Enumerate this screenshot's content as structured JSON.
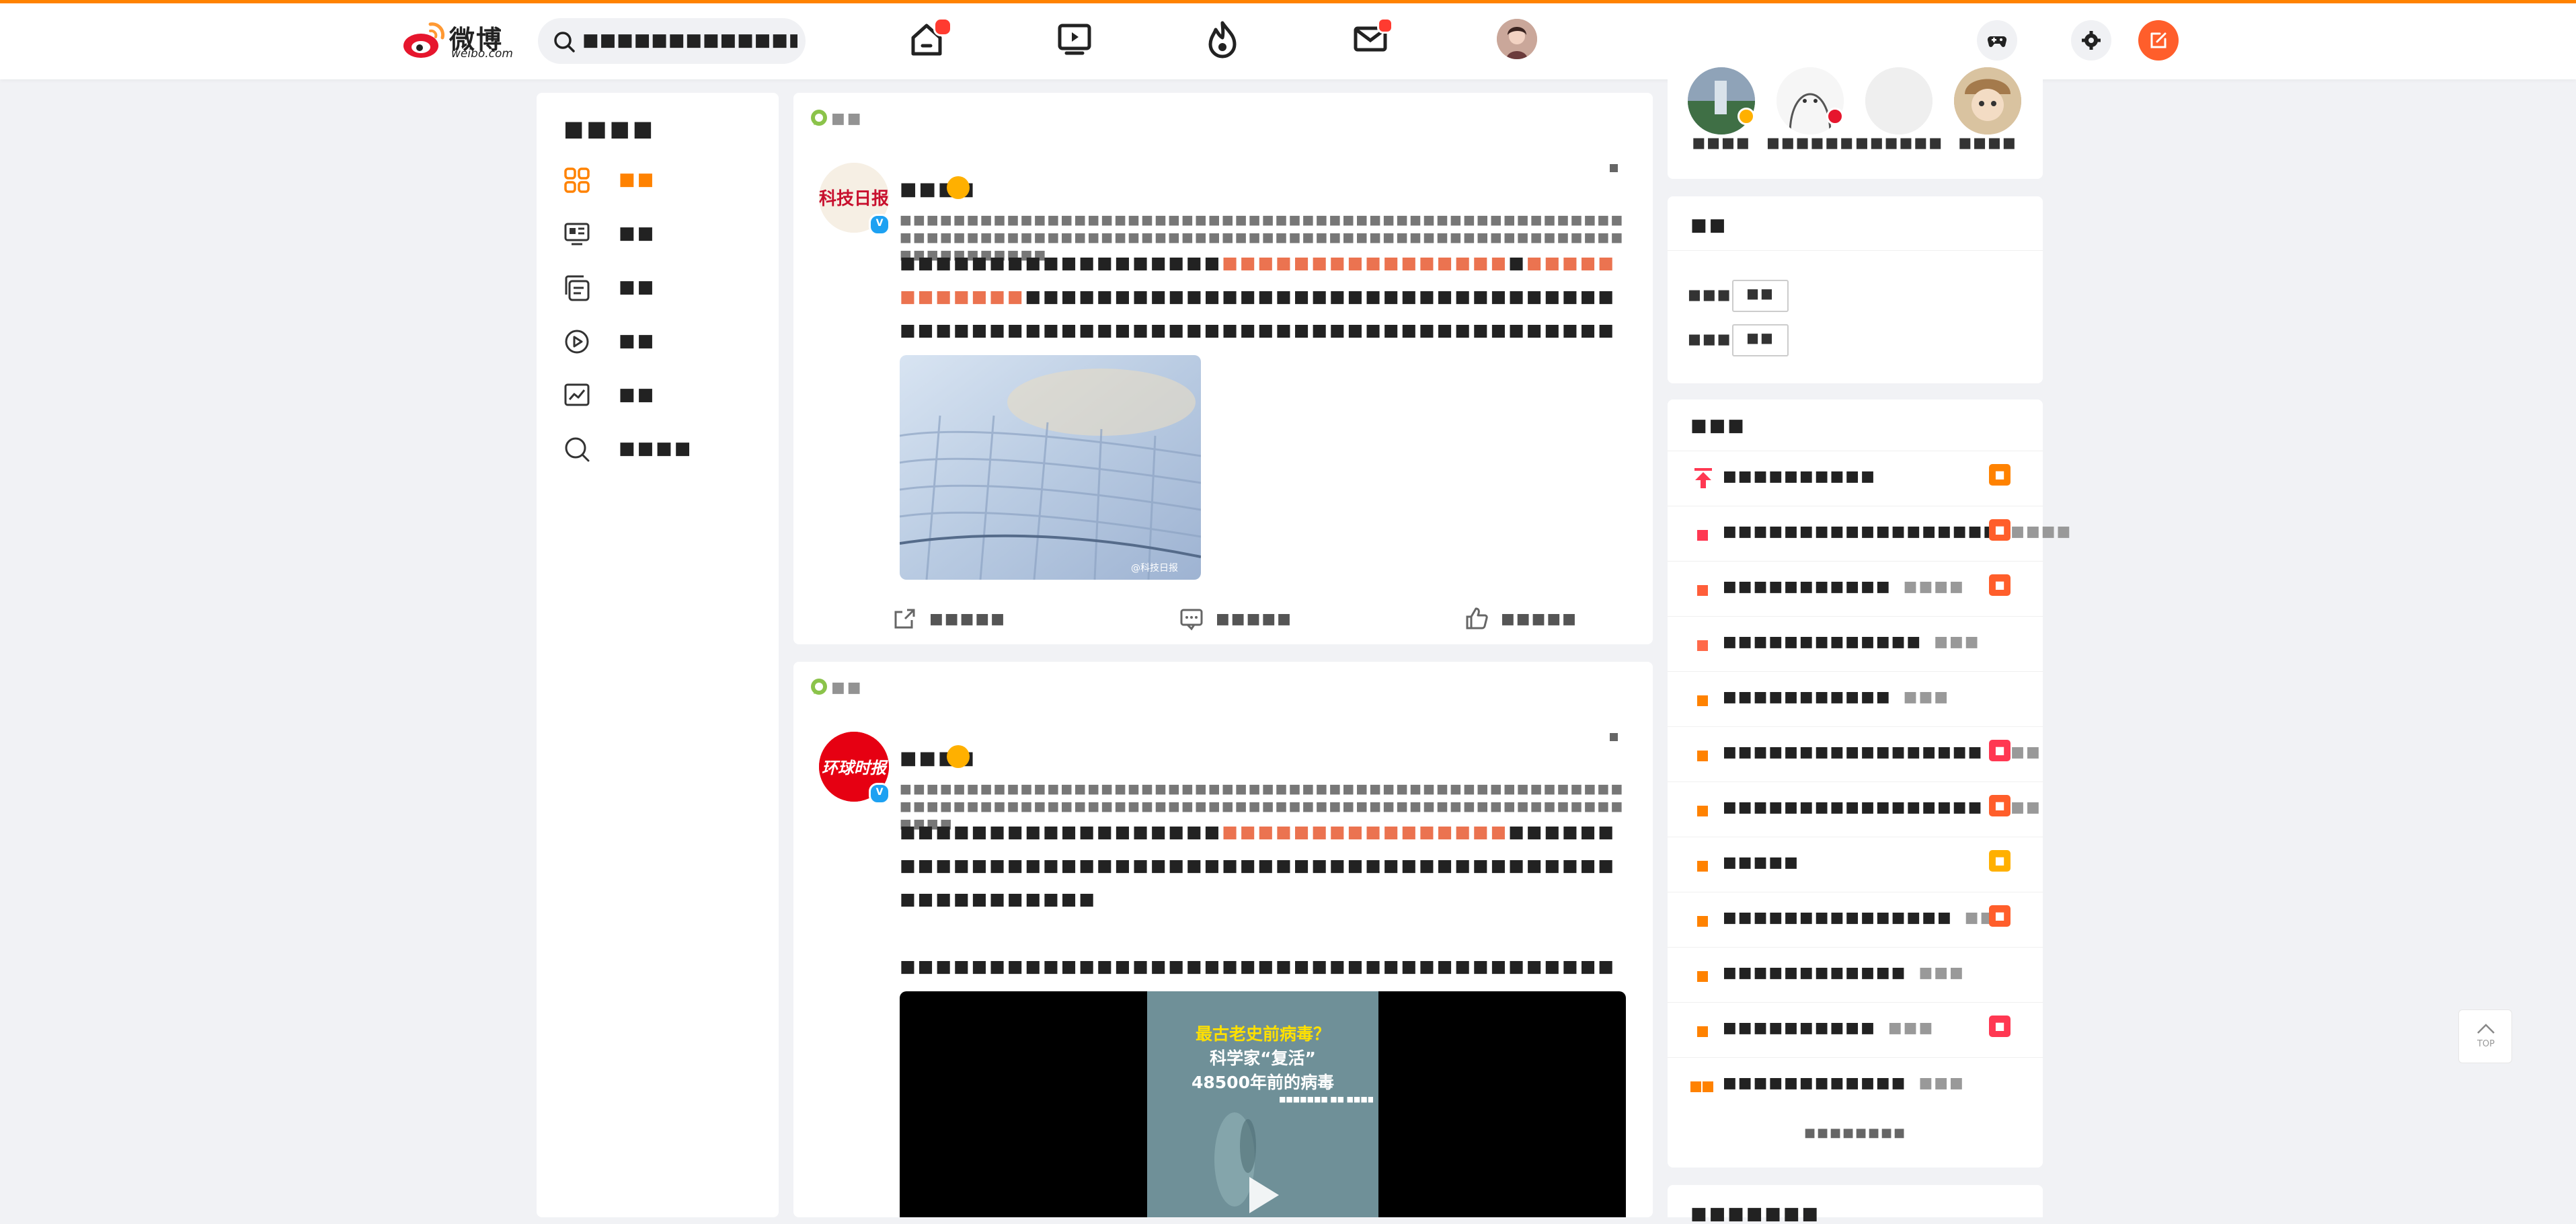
{
  "header": {
    "logo_text": "微博",
    "logo_sub": "weibo.com",
    "search_placeholder": "■■■■■■■■■■■■■■■■■■■■"
  },
  "left_nav": {
    "title": "■■■■",
    "items": [
      {
        "label": "■■",
        "icon": "grid-icon",
        "active": true
      },
      {
        "label": "■■",
        "icon": "news-icon"
      },
      {
        "label": "■■",
        "icon": "album-icon"
      },
      {
        "label": "■■",
        "icon": "video-play-icon"
      },
      {
        "label": "■■",
        "icon": "trend-chart-icon"
      },
      {
        "label": "■■■■",
        "icon": "search-icon"
      }
    ]
  },
  "feed": [
    {
      "source_label": "■■",
      "user_name": "■■■■",
      "meta_line": "■■■■■■■■■■■■■■■■■■■■■■■■■■■■■■■■■■■■■■■■■■■■■■■■■■■■■■■■■■■■■■■■■■■■■■■■■■■■■■■■■■■■■■■■■■■■■■■■■■■■■■■■■■■■■■■■■■■■■■■",
      "text_a": "■■■■■■■■■■■■■■■■■■",
      "text_hl1": "■■■■■■■■■■■■■■■■",
      "text_b": "■",
      "text_hl2": "■■■■■■■■■■■■",
      "text_c": "■■■■■■■■■■■■■■■■■■■■■■■■■■■■■■■■■■■■■■■■■■■■■■■■■■■■■■■■■■■■■■■■■■■■■■■■■■■■■■■■■■■■■■",
      "text_more": "■■▪",
      "actions": {
        "share": "■■■■■",
        "comment": "■■■■■",
        "like": "■■■■■"
      },
      "watermark": "@科技日报"
    },
    {
      "source_label": "■■",
      "user_name": "■■■■",
      "meta_line": "■■■■■■■■■■■■■■■■■■■■■■■■■■■■■■■■■■■■■■■■■■■■■■■■■■■■■■■■■■■■■■■■■■■■■■■■■■■■■■■■■■■■■■■■■■■■■■■■■■■■■■■■■■■■■■■■",
      "text_a": "■■■■■■■■■■■■■■■■■■",
      "text_hl1": "■■■■■■■■■■■■■■■■",
      "text_b": "■■■■■■■■■■■■■■■■■■■■■■■■■■■■■■■■■■■■■■■■■■■■■■■■■■■■■■■■■",
      "text_c": "■■■■■■■■■■■■■■■■■■■■■■■■■■■■■■■■■■■■■■■■■■■■■■■■■■■■",
      "text_more": "■■▪",
      "video_caption_1": "最古老史前病毒？",
      "video_caption_2": "科学家“复活”",
      "video_caption_3": "48500年前的病毒",
      "video_source": "■■■■■■■ ■■ ■■■■■"
    }
  ],
  "right": {
    "follows": [
      {
        "name": "■■■■",
        "badge": "v-gold"
      },
      {
        "name": "■■■■■■…",
        "badge": "v-red"
      },
      {
        "name": "■■■■■■…",
        "badge": ""
      },
      {
        "name": "■■■■",
        "badge": ""
      }
    ],
    "tags_title": "■■",
    "tags": [
      {
        "label": "■■■",
        "pill": "■■"
      },
      {
        "label": "■■■",
        "pill": "■■"
      }
    ],
    "hot_title": "■■■",
    "hot": [
      {
        "title": "■■■■■■■■■■",
        "count": "",
        "badge": "■",
        "badge_color": "#ff8200",
        "pinned": true
      },
      {
        "title": "■■■■■■■■■■■■■■■■■■",
        "count": "■■■■",
        "badge": "■",
        "badge_color": "#ff5e2b"
      },
      {
        "title": "■■■■■■■■■■■",
        "count": "■■■■",
        "badge": "■",
        "badge_color": "#ff5e2b"
      },
      {
        "title": "■■■■■■■■■■■■■",
        "count": "■■■",
        "badge": "",
        "badge_color": ""
      },
      {
        "title": "■■■■■■■■■■■",
        "count": "■■■",
        "badge": "",
        "badge_color": ""
      },
      {
        "title": "■■■■■■■■■■■■■■■■■",
        "count": "■■■",
        "badge": "■",
        "badge_color": "#ff3852"
      },
      {
        "title": "■■■■■■■■■■■■■■■■■",
        "count": "■■■",
        "badge": "■",
        "badge_color": "#ff5e2b"
      },
      {
        "title": "■■■■■",
        "count": "",
        "badge": "■",
        "badge_color": "#ffb000"
      },
      {
        "title": "■■■■■■■■■■■■■■■",
        "count": "■■■",
        "badge": "■",
        "badge_color": "#ff5e2b"
      },
      {
        "title": "■■■■■■■■■■■■",
        "count": "■■■",
        "badge": "",
        "badge_color": ""
      },
      {
        "title": "■■■■■■■■■■",
        "count": "■■■",
        "badge": "■",
        "badge_color": "#ff3852"
      },
      {
        "title": "■■■■■■■■■■■■",
        "count": "■■■",
        "badge": "",
        "badge_color": ""
      }
    ],
    "hot_more": "■■■■■■■■",
    "next_title": "■■■■■■■"
  },
  "to_top": "TOP"
}
